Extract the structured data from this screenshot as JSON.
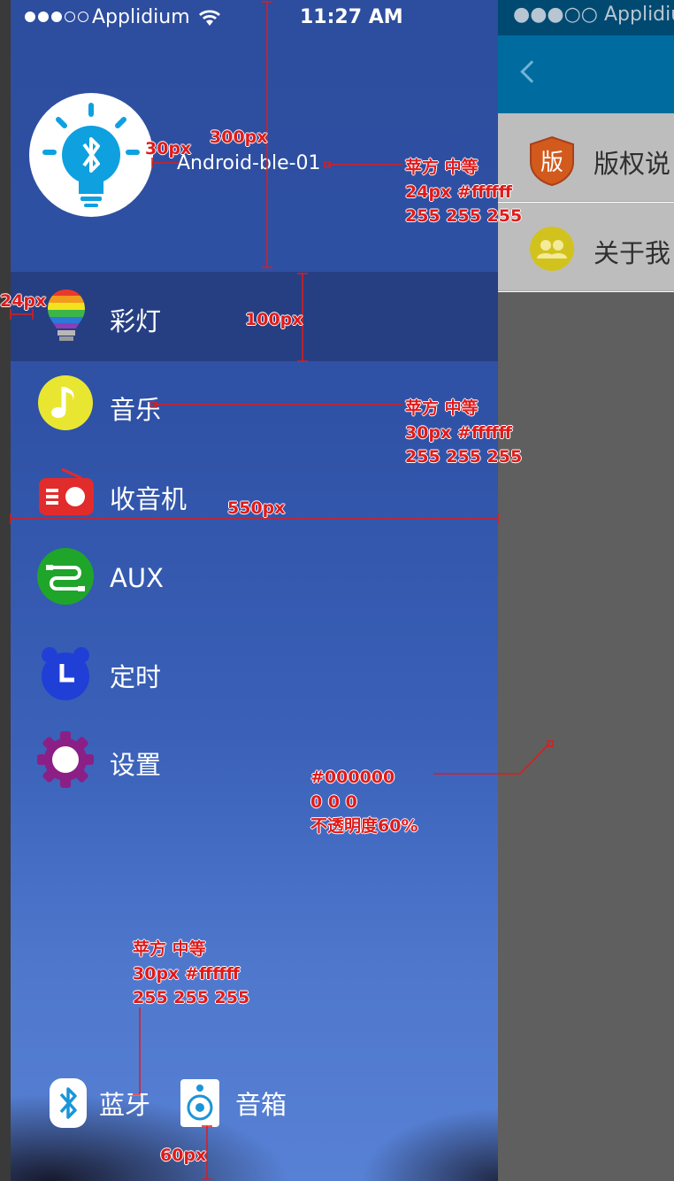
{
  "background_app": {
    "status_text": "●●●○○ Applidium",
    "rows": [
      {
        "label": "版权说",
        "icon_glyph": "版",
        "icon": "shield-icon"
      },
      {
        "label": "关于我",
        "icon": "chat-group-icon"
      }
    ]
  },
  "status_bar": {
    "carrier": "Applidium",
    "time": "11:27 AM",
    "signal_filled": 3,
    "signal_total": 5
  },
  "drawer": {
    "device_name": "Android-ble-01",
    "menu": [
      {
        "label": "彩灯",
        "icon": "rainbow-bulb-icon",
        "selected": true
      },
      {
        "label": "音乐",
        "icon": "music-note-icon"
      },
      {
        "label": "收音机",
        "icon": "radio-icon"
      },
      {
        "label": "AUX",
        "icon": "aux-cable-icon"
      },
      {
        "label": "定时",
        "icon": "alarm-clock-icon"
      },
      {
        "label": "设置",
        "icon": "gear-icon"
      }
    ],
    "bottom": {
      "bluetooth_label": "蓝牙",
      "speaker_label": "音箱"
    }
  },
  "annotations": {
    "a300": "300px",
    "a30": "30px",
    "name_spec": [
      "苹方 中等",
      "24px #ffffff",
      "255 255 255"
    ],
    "a24": "24px",
    "a100": "100px",
    "music_spec": [
      "苹方 中等",
      "30px #ffffff",
      "255 255 255"
    ],
    "a550": "550px",
    "overlay_spec": [
      "#000000",
      "0 0 0",
      "不透明度60%"
    ],
    "bottom_spec": [
      "苹方 中等",
      "30px #ffffff",
      "255 255 255"
    ],
    "a60": "60px"
  },
  "colors": {
    "drawer_top": "#2d4d9e",
    "drawer_bottom": "#5781d5",
    "selected_row": "#263f82",
    "annotation": "#e01b1b",
    "topbar": "#006b9e"
  }
}
